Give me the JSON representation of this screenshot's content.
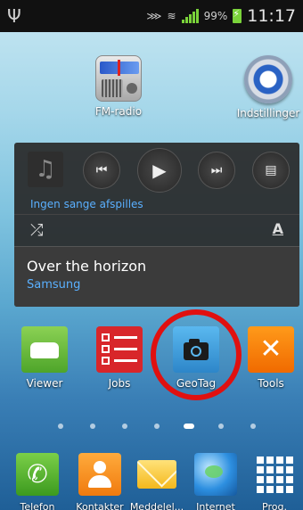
{
  "status_bar": {
    "usb_icon": "usb-icon",
    "battery_percent": "99%",
    "time": "11:17"
  },
  "top_apps": [
    {
      "label": "FM-radio",
      "icon": "fm-radio-icon"
    },
    {
      "label": "Indstillinger",
      "icon": "settings-gear-icon"
    }
  ],
  "music_widget": {
    "no_songs_text": "Ingen sange afspilles",
    "song_title": "Over the horizon",
    "artist": "Samsung",
    "controls": {
      "prev": "⏮",
      "play": "▶",
      "next": "⏭",
      "playlist": "▤",
      "shuffle": "⤮",
      "repeat": "A"
    }
  },
  "home_apps": [
    {
      "label": "Viewer",
      "icon": "car-icon"
    },
    {
      "label": "Jobs",
      "icon": "checklist-icon"
    },
    {
      "label": "GeoTag",
      "icon": "camera-icon"
    },
    {
      "label": "Tools",
      "icon": "tools-icon"
    }
  ],
  "page_indicator": {
    "total_pages": 7,
    "active_page": 5
  },
  "dock": [
    {
      "label": "Telefon",
      "icon": "phone-icon"
    },
    {
      "label": "Kontakter",
      "icon": "contacts-icon"
    },
    {
      "label": "Meddelel...",
      "icon": "message-icon"
    },
    {
      "label": "Internet",
      "icon": "globe-icon"
    },
    {
      "label": "Prog.",
      "icon": "apps-grid-icon"
    }
  ],
  "colors": {
    "accent_blue": "#5ab0ff",
    "highlight_red": "#e01010"
  }
}
